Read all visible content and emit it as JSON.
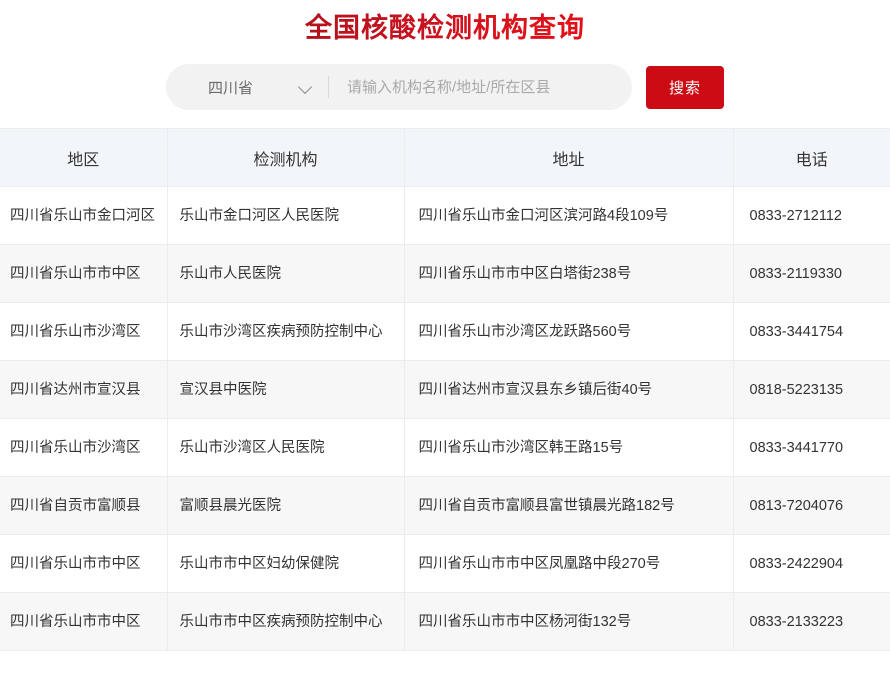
{
  "header": {
    "title": "全国核酸检测机构查询"
  },
  "search": {
    "region_value": "四川省",
    "region_icon": "chevron-down-icon",
    "keyword_value": "",
    "keyword_placeholder": "请输入机构名称/地址/所在区县",
    "submit_label": "搜索",
    "button_color": "#cc0b14"
  },
  "table": {
    "columns": [
      "地区",
      "检测机构",
      "地址",
      "电话"
    ],
    "rows": [
      {
        "region": "四川省乐山市金口河区",
        "org": "乐山市金口河区人民医院",
        "address": "四川省乐山市金口河区滨河路4段109号",
        "phone": "0833-2712112"
      },
      {
        "region": "四川省乐山市市中区",
        "org": "乐山市人民医院",
        "address": "四川省乐山市市中区白塔街238号",
        "phone": "0833-2119330"
      },
      {
        "region": "四川省乐山市沙湾区",
        "org": "乐山市沙湾区疾病预防控制中心",
        "address": "四川省乐山市沙湾区龙跃路560号",
        "phone": "0833-3441754"
      },
      {
        "region": "四川省达州市宣汉县",
        "org": "宣汉县中医院",
        "address": "四川省达州市宣汉县东乡镇后街40号",
        "phone": "0818-5223135"
      },
      {
        "region": "四川省乐山市沙湾区",
        "org": "乐山市沙湾区人民医院",
        "address": "四川省乐山市沙湾区韩王路15号",
        "phone": "0833-3441770"
      },
      {
        "region": "四川省自贡市富顺县",
        "org": "富顺县晨光医院",
        "address": "四川省自贡市富顺县富世镇晨光路182号",
        "phone": "0813-7204076"
      },
      {
        "region": "四川省乐山市市中区",
        "org": "乐山市市中区妇幼保健院",
        "address": "四川省乐山市市中区凤凰路中段270号",
        "phone": "0833-2422904"
      },
      {
        "region": "四川省乐山市市中区",
        "org": "乐山市市中区疾病预防控制中心",
        "address": "四川省乐山市市中区杨河街132号",
        "phone": "0833-2133223"
      }
    ]
  }
}
